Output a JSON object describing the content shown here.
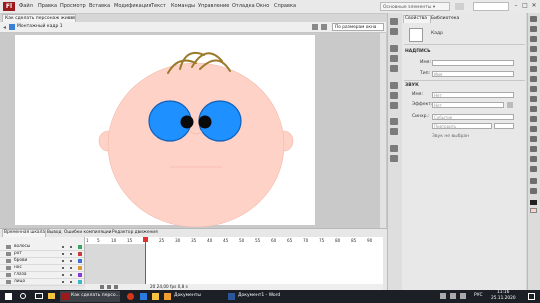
{
  "app": {
    "logo": "Fl"
  },
  "menu": [
    "Файл",
    "Правка",
    "Просмотр",
    "Вставка",
    "Модификация",
    "Текст",
    "Команды",
    "Управление",
    "Отладка",
    "Окно",
    "Справка"
  ],
  "workspace": "Основные элементы ▾",
  "window_controls": [
    "–",
    "□",
    "✕"
  ],
  "document_tab": {
    "title": "Как сделать персонаж живым.fla*",
    "close": "×"
  },
  "edit_bar": {
    "scene_label": "Монтажный кадр 1",
    "zoom": "По размерам окна"
  },
  "colors": {
    "face": "#ffd2c8",
    "face_stroke": "#f2b8a8",
    "eye": "#1e90ff",
    "eye_stroke": "#1060b8",
    "pupil": "#0a0a0a",
    "hair": "#9c7a2c",
    "accent": "#9b1b1b"
  },
  "properties": {
    "tabs": [
      "Свойства",
      "Библиотека"
    ],
    "symbol_type": "Кадр",
    "label_section": "НАДПИСЬ",
    "name_label": "Имя:",
    "type_label": "Тип:",
    "type_value": "Имя",
    "sound_section": "ЗВУК",
    "sound_name_label": "Имя:",
    "sound_name_value": "Нет",
    "effect_label": "Эффект:",
    "effect_value": "Нет",
    "sync_label": "Синхр.:",
    "sync_value": "Событие",
    "repeat_value": "Повторить",
    "sound_status": "Звук не выбран"
  },
  "timeline": {
    "tabs": [
      "Временная шкала",
      "Вывод",
      "Ошибки компиляции",
      "Редактор движения"
    ],
    "layers": [
      {
        "name": "волосы",
        "color": "#3aa35a"
      },
      {
        "name": "рот",
        "color": "#c43c3c"
      },
      {
        "name": "брови",
        "color": "#3a6fd8"
      },
      {
        "name": "нос",
        "color": "#d89a3a"
      },
      {
        "name": "глаза",
        "color": "#8a3ad8"
      },
      {
        "name": "лицо",
        "color": "#3ab8c4"
      }
    ],
    "frame_numbers": [
      "1",
      "5",
      "10",
      "15",
      "20",
      "25",
      "30",
      "35",
      "40",
      "45",
      "50",
      "55",
      "60",
      "65",
      "70",
      "75",
      "80",
      "85",
      "90"
    ],
    "status": "20   24,00 fps   0,8 s"
  },
  "taskbar": {
    "app_labels": [
      "Как сделать персо...",
      "Документы",
      "Документ1 - Word"
    ],
    "language": "РУС",
    "time": "11:16",
    "date": "25.11.2020"
  }
}
